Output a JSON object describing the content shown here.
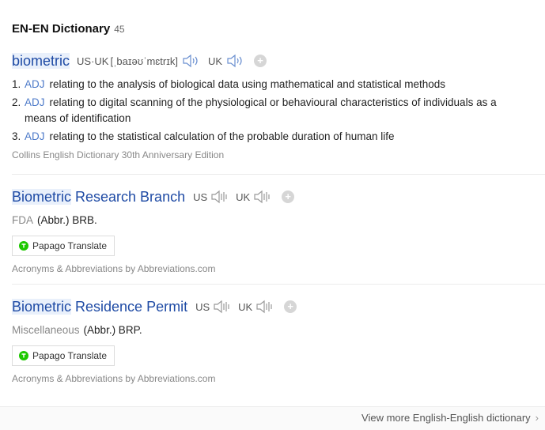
{
  "header": {
    "title": "EN-EN Dictionary",
    "count": "45"
  },
  "entry1": {
    "headword": "biometric",
    "us_uk_label": "US·UK",
    "pronunciation": "[ˌbaɪəʊˈmɛtrɪk]",
    "uk_label": "UK",
    "definitions": [
      {
        "num": "1.",
        "pos": "ADJ",
        "text": "relating to the analysis of biological data using mathematical and statistical methods"
      },
      {
        "num": "2.",
        "pos": "ADJ",
        "text": "relating to digital scanning of the physiological or behavioural characteristics of individuals as a means of identification"
      },
      {
        "num": "3.",
        "pos": "ADJ",
        "text": "relating to the statistical calculation of the probable duration of human life"
      }
    ],
    "source": "Collins English Dictionary 30th Anniversary Edition"
  },
  "entry2": {
    "headword_highlight": "Biometric",
    "headword_rest": "Research Branch",
    "us_label": "US",
    "uk_label": "UK",
    "tag": "FDA",
    "abbr": "(Abbr.) BRB.",
    "papago_label": "Papago Translate",
    "source": "Acronyms & Abbreviations by Abbreviations.com"
  },
  "entry3": {
    "headword_highlight": "Biometric",
    "headword_rest": "Residence Permit",
    "us_label": "US",
    "uk_label": "UK",
    "tag": "Miscellaneous",
    "abbr": "(Abbr.) BRP.",
    "papago_label": "Papago Translate",
    "source": "Acronyms & Abbreviations by Abbreviations.com"
  },
  "footer": {
    "link_label": "View more English-English dictionary"
  },
  "colors": {
    "headword": "#1f4ba5",
    "highlight": "#e9f0fb",
    "pos": "#4d7ac9",
    "muted": "#888888"
  },
  "icons": {
    "speaker": "speaker-icon",
    "add": "plus-icon",
    "papago": "papago-icon",
    "chevron": "chevron-right-icon"
  }
}
